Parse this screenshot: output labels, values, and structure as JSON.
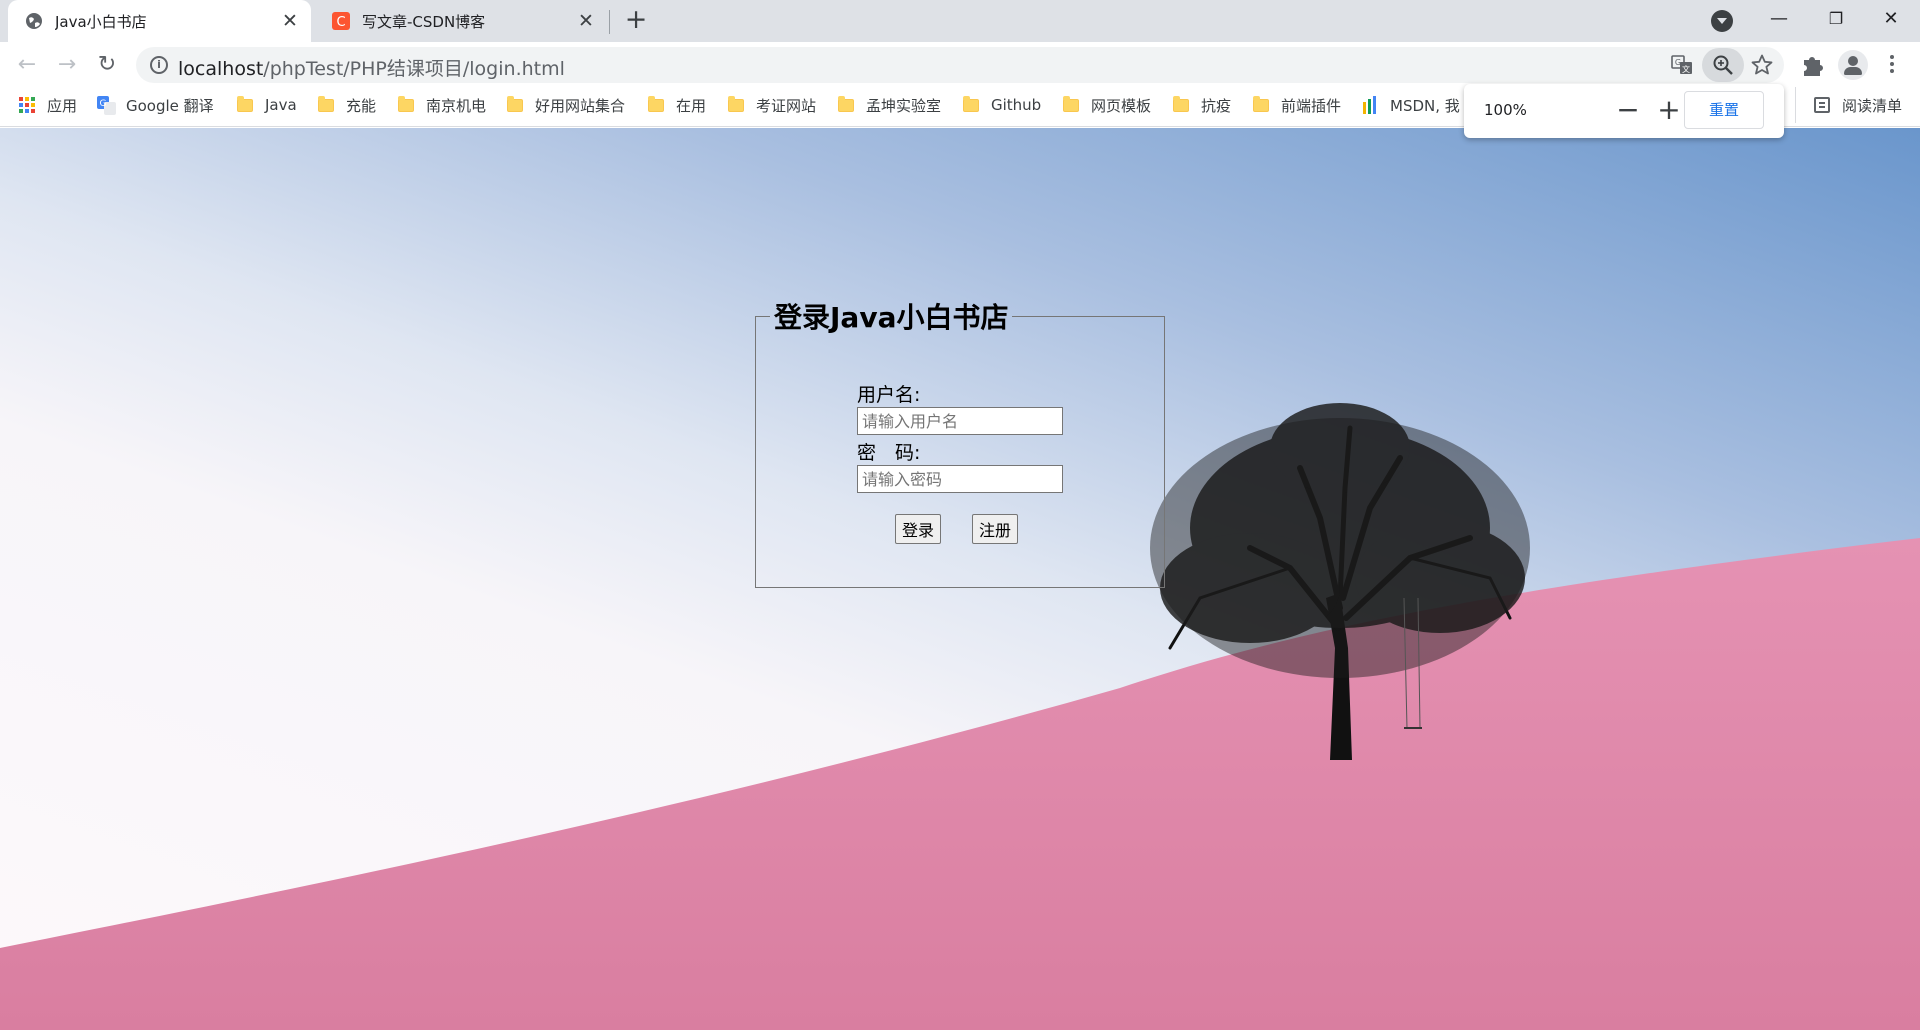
{
  "tabs": [
    {
      "title": "Java小白书店",
      "active": true,
      "icon": "globe-icon"
    },
    {
      "title": "写文章-CSDN博客",
      "active": false,
      "icon": "csdn-icon",
      "icon_color": "#fc5531"
    }
  ],
  "address_bar": {
    "host": "localhost",
    "path": "/phpTest/PHP结课项目/login.html"
  },
  "bookmarks": [
    {
      "label": "应用",
      "icon": "apps-grid-icon"
    },
    {
      "label": "Google 翻译",
      "icon": "google-translate-icon"
    },
    {
      "label": "Java",
      "icon": "folder-icon"
    },
    {
      "label": "充能",
      "icon": "folder-icon"
    },
    {
      "label": "南京机电",
      "icon": "folder-icon"
    },
    {
      "label": "好用网站集合",
      "icon": "folder-icon"
    },
    {
      "label": "在用",
      "icon": "folder-icon"
    },
    {
      "label": "考证网站",
      "icon": "folder-icon"
    },
    {
      "label": "孟坤实验室",
      "icon": "folder-icon"
    },
    {
      "label": "Github",
      "icon": "folder-icon"
    },
    {
      "label": "网页模板",
      "icon": "folder-icon"
    },
    {
      "label": "抗疫",
      "icon": "folder-icon"
    },
    {
      "label": "前端插件",
      "icon": "folder-icon"
    },
    {
      "label": "MSDN, 我",
      "icon": "msdn-icon"
    }
  ],
  "reading_list": "阅读清单",
  "zoom_popup": {
    "level": "100%",
    "minus": "−",
    "plus": "+",
    "reset": "重置"
  },
  "login": {
    "legend": "登录Java小白书店",
    "username_label": "用户名:",
    "username_placeholder": "请输入用户名",
    "password_label": "密　码:",
    "password_placeholder": "请输入密码",
    "login_button": "登录",
    "register_button": "注册"
  },
  "colors": {
    "accent": "#1a73e8",
    "hill_pink": "#e08aab"
  }
}
